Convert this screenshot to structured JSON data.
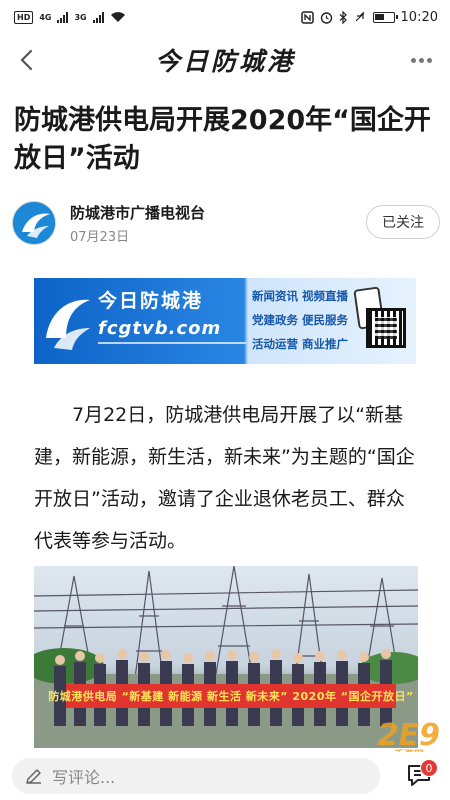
{
  "status_bar": {
    "left_badge": "HD",
    "network_1": "4G",
    "network_2": "3G",
    "time": "10:20",
    "icons": [
      "nfc-icon",
      "alarm-icon",
      "bluetooth-icon",
      "silent-icon",
      "battery-icon"
    ]
  },
  "nav": {
    "title": "今日防城港",
    "back_icon": "chevron-left-icon",
    "more_icon": "more-dots-icon"
  },
  "article": {
    "title": "防城港供电局开展2020年“国企开放日”活动",
    "author": "防城港市广播电视台",
    "date": "07月23日",
    "follow_label": "已关注",
    "body": "7月22日，防城港供电局开展了以“新基建，新能源，新生活，新未来”为主题的“国企开放日”活动，邀请了企业退休老员工、群众代表等参与活动。"
  },
  "banner": {
    "title": "今日防城港",
    "url": "fcgtvb.com",
    "services_line1": "新闻资讯 视频直播",
    "services_line2": "党建政务 便民服务",
    "services_line3": "活动运营 商业推广"
  },
  "photo": {
    "banner_text": "防城港供电局 “新基建 新能源 新生活 新未来” 2020年 “国企开放日”"
  },
  "watermark": {
    "main": "2E9",
    "sub": "手游网"
  },
  "comment_bar": {
    "placeholder": "写评论...",
    "comment_count": "0",
    "edit_icon": "pencil-icon",
    "comments_icon": "comment-list-icon"
  },
  "colors": {
    "accent_blue": "#1e88d8",
    "badge_red": "#e53935",
    "banner_red": "#e0342e"
  }
}
